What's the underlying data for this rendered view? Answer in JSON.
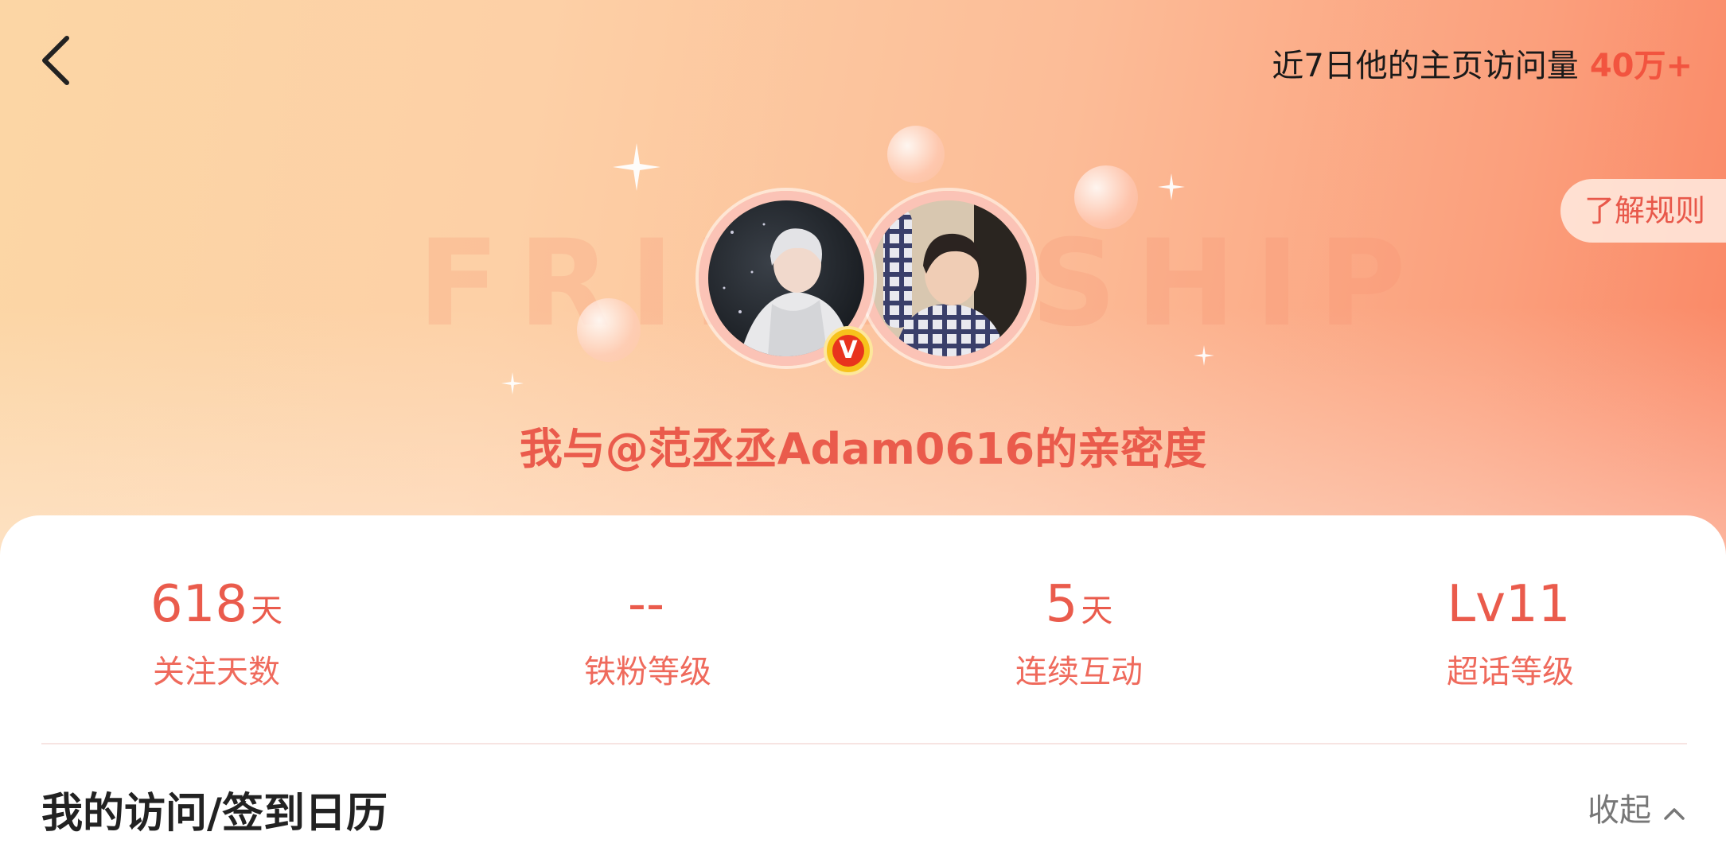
{
  "header": {
    "visits_text": "近7日他的主页访问量",
    "visits_count": "40万+",
    "rules_button": "了解规则",
    "watermark": "FRIENDSHIP"
  },
  "intimacy": {
    "title": "我与@范丞丞Adam0616的亲密度",
    "verified_badge": "V"
  },
  "stats": [
    {
      "value": "618",
      "unit": "天",
      "label": "关注天数"
    },
    {
      "value": "--",
      "unit": "",
      "label": "铁粉等级"
    },
    {
      "value": "5",
      "unit": "天",
      "label": "连续互动"
    },
    {
      "value": "Lv11",
      "unit": "",
      "label": "超话等级"
    }
  ],
  "calendar": {
    "title": "我的访问/签到日历",
    "collapse_label": "收起"
  },
  "colors": {
    "accent": "#ea5b4c",
    "visits_highlight": "#f2543f",
    "badge_gold": "#f7c21c"
  },
  "icons": {
    "back": "chevron-left-icon",
    "collapse": "chevron-up-icon"
  }
}
